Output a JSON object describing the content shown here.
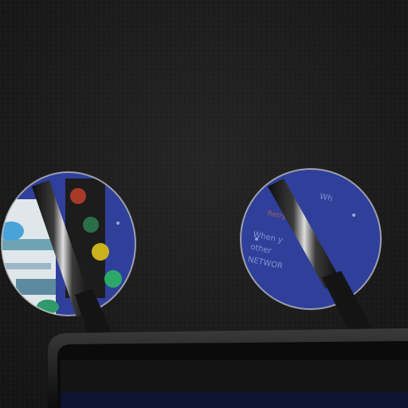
{
  "scene": {
    "title": "",
    "colors": {
      "fabric": "#1d1d1d",
      "screen_blue": "#2f3f9a",
      "traffic_red": "#a83a2a",
      "traffic_yellow": "#c9b21e",
      "traffic_green": "#2ea86a",
      "device_frame": "#0b0b0b"
    }
  },
  "right_peephole": {
    "lines": [
      "Wh",
      "Retry",
      "When y",
      "other",
      "NETWOR"
    ]
  }
}
